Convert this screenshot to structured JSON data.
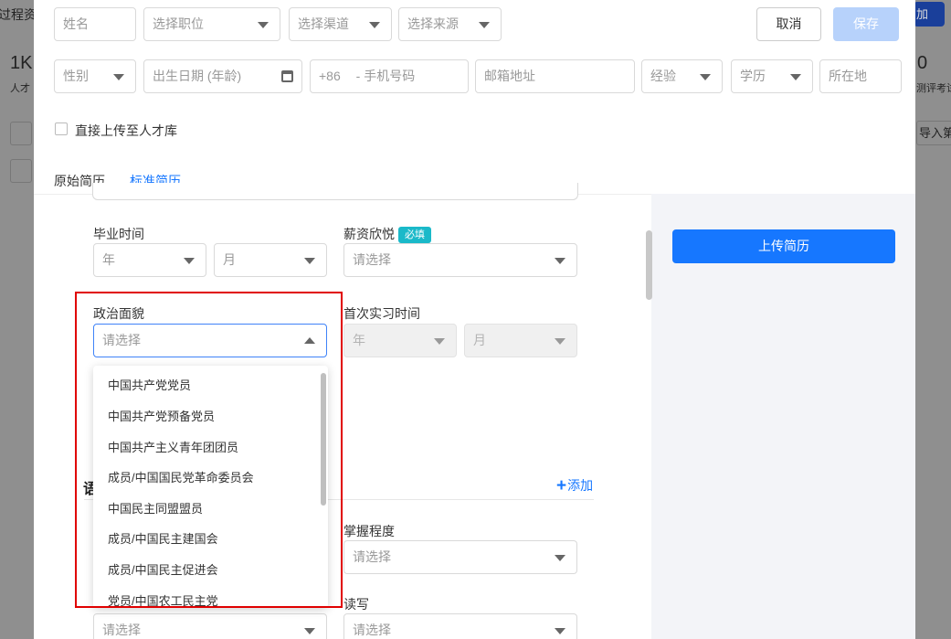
{
  "background": {
    "text_top_left": "过程资",
    "stat_value": "1K",
    "stat_label": "人才",
    "add_button": "加",
    "stat_right_value": "0",
    "stat_right_label": "测评考试",
    "import_button": "导入第"
  },
  "header_row1": {
    "name_placeholder": "姓名",
    "position_placeholder": "选择职位",
    "channel_placeholder": "选择渠道",
    "source_placeholder": "选择来源",
    "cancel_label": "取消",
    "save_label": "保存"
  },
  "header_row2": {
    "gender_placeholder": "性别",
    "birth_placeholder": "出生日期 (年龄)",
    "phone_prefix": "+86",
    "phone_placeholder": "- 手机号码",
    "email_placeholder": "邮箱地址",
    "experience_placeholder": "经验",
    "education_placeholder": "学历",
    "location_placeholder": "所在地"
  },
  "upload_to_pool_label": "直接上传至人才库",
  "tabs": [
    {
      "label": "原始简历",
      "active": false
    },
    {
      "label": "标准简历",
      "active": true
    }
  ],
  "form": {
    "graduation_label": "毕业时间",
    "graduation_year_placeholder": "年",
    "graduation_month_placeholder": "月",
    "salary_label": "薪资欣悦",
    "required_badge": "必填",
    "salary_placeholder": "请选择",
    "political_label": "政治面貌",
    "political_placeholder": "请选择",
    "internship_label": "首次实习时间",
    "internship_year_placeholder": "年",
    "internship_month_placeholder": "月",
    "section_title_fragment": "语",
    "add_label": "添加",
    "mastery_label": "掌握程度",
    "mastery_placeholder": "请选择",
    "read_write_label": "读写",
    "read_write_placeholder": "请选择",
    "bottom_left_placeholder": "请选择"
  },
  "political_options": [
    "中国共产党党员",
    "中国共产党预备党员",
    "中国共产主义青年团团员",
    "成员/中国国民党革命委员会",
    "中国民主同盟盟员",
    "成员/中国民主建国会",
    "成员/中国民主促进会",
    "党员/中国农工民主党"
  ],
  "upload_resume_label": "上传简历",
  "colors": {
    "primary": "#1677ff",
    "save_disabled": "#b7d2fb",
    "badge": "#1ab9c9",
    "highlight": "#e00000",
    "right_panel": "#f3f4f8"
  }
}
